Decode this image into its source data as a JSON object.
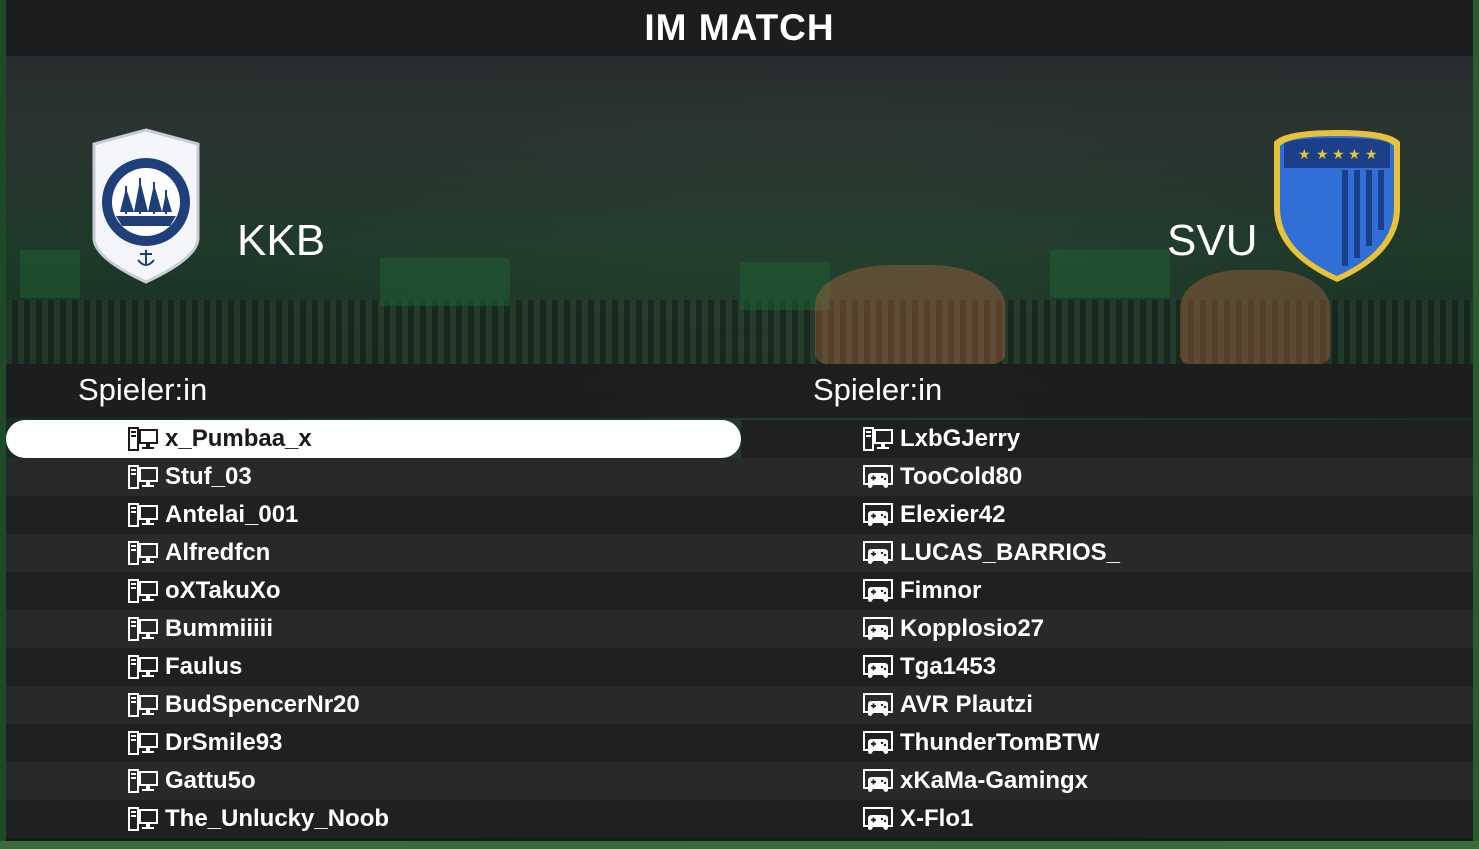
{
  "header": {
    "title": "IM MATCH"
  },
  "home": {
    "team": "KKB",
    "crest": "ship-badge-icon",
    "players_label": "Spieler:in",
    "players": [
      {
        "name": "x_Pumbaa_x",
        "platform": "pc-icon",
        "selected": true
      },
      {
        "name": "Stuf_03",
        "platform": "pc-icon"
      },
      {
        "name": "Antelai_001",
        "platform": "pc-icon"
      },
      {
        "name": "Alfredfcn",
        "platform": "pc-icon"
      },
      {
        "name": "oXTakuXo",
        "platform": "pc-icon"
      },
      {
        "name": "Bummiiiii",
        "platform": "pc-icon"
      },
      {
        "name": "Faulus",
        "platform": "pc-icon"
      },
      {
        "name": "BudSpencerNr20",
        "platform": "pc-icon"
      },
      {
        "name": "DrSmile93",
        "platform": "pc-icon"
      },
      {
        "name": "Gattu5o",
        "platform": "pc-icon"
      },
      {
        "name": "The_Unlucky_Noob",
        "platform": "pc-icon"
      }
    ]
  },
  "away": {
    "team": "SVU",
    "crest": "blue-shield-stars-icon",
    "players_label": "Spieler:in",
    "players": [
      {
        "name": "LxbGJerry",
        "platform": "pc-icon"
      },
      {
        "name": "TooCold80",
        "platform": "console-icon"
      },
      {
        "name": "Elexier42",
        "platform": "console-icon"
      },
      {
        "name": "LUCAS_BARRIOS_",
        "platform": "console-icon"
      },
      {
        "name": "Fimnor",
        "platform": "console-icon"
      },
      {
        "name": "Kopplosio27",
        "platform": "console-icon"
      },
      {
        "name": "Tga1453",
        "platform": "console-icon"
      },
      {
        "name": "AVR Plautzi",
        "platform": "console-icon"
      },
      {
        "name": "ThunderTomBTW",
        "platform": "console-icon"
      },
      {
        "name": "xKaMa-Gamingx",
        "platform": "console-icon"
      },
      {
        "name": "X-Flo1",
        "platform": "console-icon"
      }
    ]
  },
  "colors": {
    "selected_row": "#ffffff",
    "row": "#1f2022",
    "row_alt": "#28292b",
    "away_crest": "#2f6fd6",
    "crest_gold": "#e8c23a",
    "home_crest": "#1f3f7a"
  }
}
